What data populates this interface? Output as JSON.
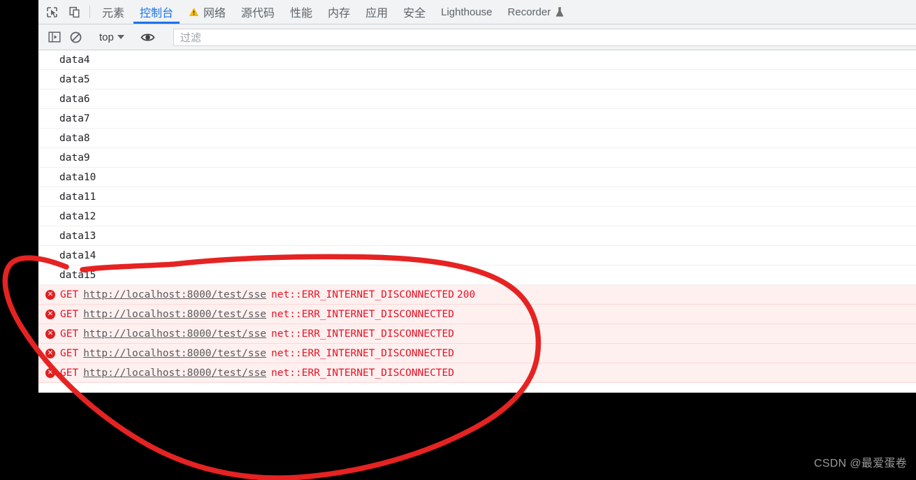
{
  "devtools": {
    "toolbar_icons": [
      {
        "name": "inspect-element-icon",
        "title": "inspect"
      },
      {
        "name": "device-toolbar-icon",
        "title": "device toolbar"
      }
    ],
    "tabs": [
      {
        "label": "元素",
        "active": false,
        "badge": null,
        "cjk": true
      },
      {
        "label": "控制台",
        "active": true,
        "badge": null,
        "cjk": true
      },
      {
        "label": "网络",
        "active": false,
        "badge": "warning",
        "cjk": true
      },
      {
        "label": "源代码",
        "active": false,
        "badge": null,
        "cjk": true
      },
      {
        "label": "性能",
        "active": false,
        "badge": null,
        "cjk": true
      },
      {
        "label": "内存",
        "active": false,
        "badge": null,
        "cjk": true
      },
      {
        "label": "应用",
        "active": false,
        "badge": null,
        "cjk": true
      },
      {
        "label": "安全",
        "active": false,
        "badge": null,
        "cjk": true
      },
      {
        "label": "Lighthouse",
        "active": false,
        "badge": null,
        "cjk": false
      },
      {
        "label": "Recorder",
        "active": false,
        "badge": "flask",
        "cjk": false
      }
    ],
    "filterbar": {
      "sidebar_toggle_icon": "sidebar-panel-icon",
      "clear_console_icon": "clear-console-icon",
      "context_label": "top",
      "eye_icon": "live-expression-eye-icon",
      "filter_placeholder": "过滤",
      "filter_value": ""
    },
    "console": {
      "log_messages": [
        "data4",
        "data5",
        "data6",
        "data7",
        "data8",
        "data9",
        "data10",
        "data11",
        "data12",
        "data13",
        "data14",
        "data15"
      ],
      "errors": [
        {
          "method": "GET",
          "url": "http://localhost:8000/test/sse",
          "message": "net::ERR_INTERNET_DISCONNECTED",
          "code": "200"
        },
        {
          "method": "GET",
          "url": "http://localhost:8000/test/sse",
          "message": "net::ERR_INTERNET_DISCONNECTED",
          "code": ""
        },
        {
          "method": "GET",
          "url": "http://localhost:8000/test/sse",
          "message": "net::ERR_INTERNET_DISCONNECTED",
          "code": ""
        },
        {
          "method": "GET",
          "url": "http://localhost:8000/test/sse",
          "message": "net::ERR_INTERNET_DISCONNECTED",
          "code": ""
        },
        {
          "method": "GET",
          "url": "http://localhost:8000/test/sse",
          "message": "net::ERR_INTERNET_DISCONNECTED",
          "code": ""
        }
      ]
    }
  },
  "annotation": {
    "type": "hand-drawn-circle",
    "color": "#e52322"
  },
  "watermark": {
    "text": "CSDN @最爱蛋卷"
  },
  "colors": {
    "accent": "#1a73e8",
    "error": "#e81123",
    "error_bg": "#fff0f0",
    "toolbar_bg": "#f1f3f4",
    "annotation": "#e52322"
  }
}
